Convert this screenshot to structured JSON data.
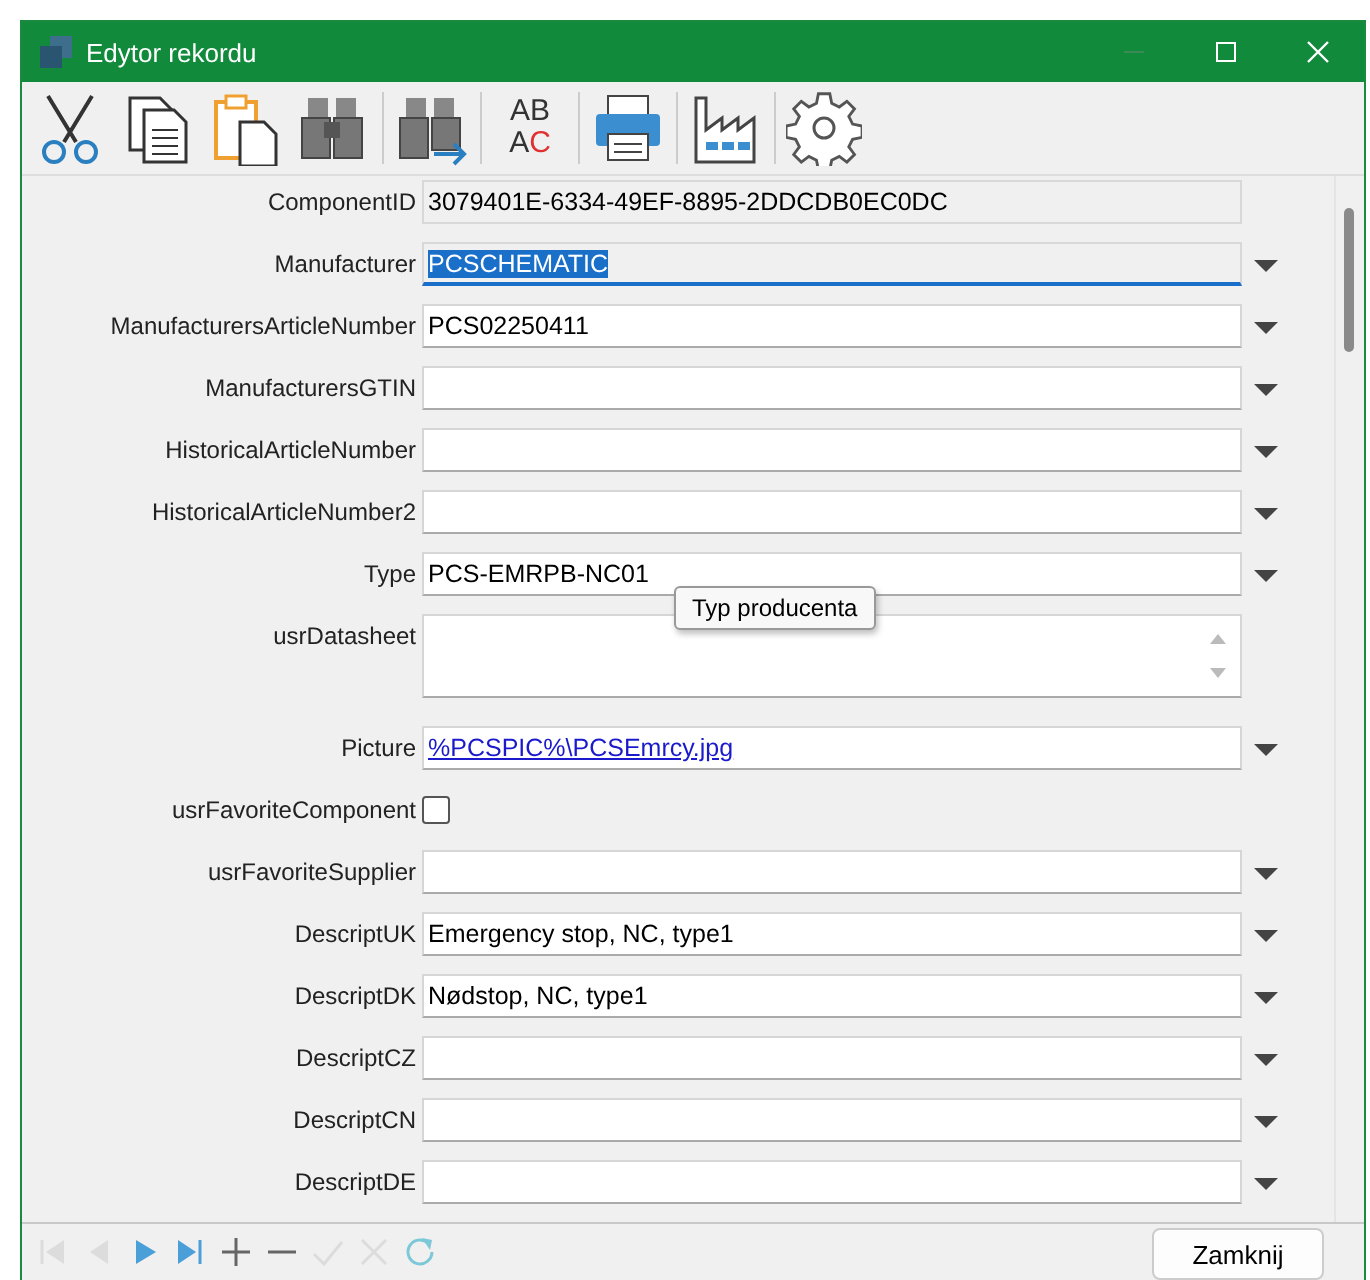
{
  "window": {
    "title": "Edytor rekordu"
  },
  "toolbar": [
    {
      "kind": "cut"
    },
    {
      "kind": "copy"
    },
    {
      "kind": "paste"
    },
    {
      "kind": "find",
      "separator_after": true
    },
    {
      "kind": "find-next",
      "separator_after": true
    },
    {
      "kind": "replace",
      "glyph_top": "AB",
      "glyph_bottom": "AC",
      "separator_after": true
    },
    {
      "kind": "print",
      "separator_after": true
    },
    {
      "kind": "factory",
      "separator_after": true
    },
    {
      "kind": "settings"
    }
  ],
  "fields": [
    {
      "label": "ComponentID",
      "kind": "text",
      "value": "3079401E-6334-49EF-8895-2DDCDB0EC0DC",
      "readonly": true,
      "dropdown": false
    },
    {
      "label": "Manufacturer",
      "kind": "text",
      "value": "PCSCHEMATIC",
      "readonly": true,
      "focused": true,
      "dropdown": true
    },
    {
      "label": "ManufacturersArticleNumber",
      "kind": "text",
      "value": "PCS02250411",
      "dropdown": true
    },
    {
      "label": "ManufacturersGTIN",
      "kind": "text",
      "dropdown": true
    },
    {
      "label": "HistoricalArticleNumber",
      "kind": "text",
      "dropdown": true
    },
    {
      "label": "HistoricalArticleNumber2",
      "kind": "text",
      "dropdown": true
    },
    {
      "label": "Type",
      "kind": "text",
      "value": "PCS-EMRPB-NC01",
      "dropdown": true,
      "tooltip": "Typ producenta"
    },
    {
      "label": "usrDatasheet",
      "kind": "memo"
    },
    {
      "label": "Picture",
      "kind": "link",
      "value": "%PCSPIC%\\PCSEmrcy.jpg",
      "dropdown": true
    },
    {
      "label": "usrFavoriteComponent",
      "kind": "checkbox",
      "checked": false
    },
    {
      "label": "usrFavoriteSupplier",
      "kind": "text",
      "dropdown": true
    },
    {
      "label": "DescriptUK",
      "kind": "text",
      "value": "Emergency stop, NC, type1",
      "dropdown": true
    },
    {
      "label": "DescriptDK",
      "kind": "text",
      "value": "Nødstop, NC, type1",
      "dropdown": true
    },
    {
      "label": "DescriptCZ",
      "kind": "text",
      "dropdown": true
    },
    {
      "label": "DescriptCN",
      "kind": "text",
      "dropdown": true
    },
    {
      "label": "DescriptDE",
      "kind": "text",
      "dropdown": true
    }
  ],
  "navigator": [
    {
      "kind": "first",
      "disabled": true
    },
    {
      "kind": "prior",
      "disabled": true
    },
    {
      "kind": "next",
      "disabled": false
    },
    {
      "kind": "last",
      "disabled": false
    },
    {
      "kind": "insert",
      "disabled": false
    },
    {
      "kind": "delete",
      "disabled": false
    },
    {
      "kind": "post",
      "disabled": true
    },
    {
      "kind": "cancel",
      "disabled": true
    },
    {
      "kind": "refresh",
      "disabled": false
    }
  ],
  "close_button": "Zamknij"
}
